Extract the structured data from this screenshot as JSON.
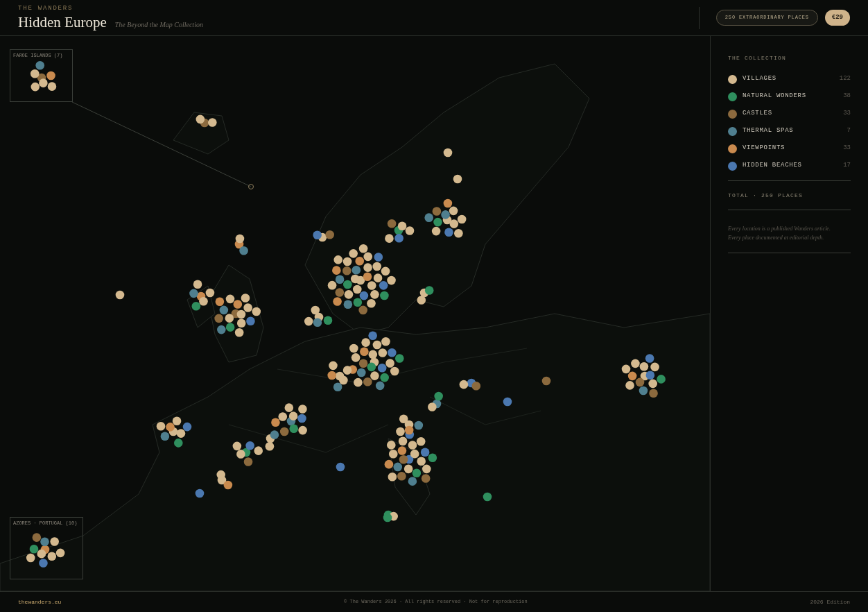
{
  "header": {
    "brand": "THE WANDERS",
    "title": "Hidden Europe",
    "subtitle": "The Beyond the Map Collection",
    "places_badge": "250 EXTRAORDINARY PLACES",
    "price_button": "€29"
  },
  "map": {
    "kind": "picture",
    "insets": [
      {
        "label": "FAROE ISLANDS (7)"
      },
      {
        "label": "AZORES · PORTUGAL (10)"
      }
    ]
  },
  "legend": {
    "title": "THE COLLECTION",
    "categories": [
      {
        "label": "VILLAGES",
        "count": "122",
        "color": "#d4b98f"
      },
      {
        "label": "NATURAL WONDERS",
        "count": "38",
        "color": "#2f8f5e"
      },
      {
        "label": "CASTLES",
        "count": "33",
        "color": "#8c6a3e"
      },
      {
        "label": "THERMAL SPAS",
        "count": "7",
        "color": "#4f7f8f"
      },
      {
        "label": "VIEWPOINTS",
        "count": "33",
        "color": "#c98a4e"
      },
      {
        "label": "HIDDEN BEACHES",
        "count": "17",
        "color": "#4b78b0"
      }
    ],
    "total": "TOTAL · 250 PLACES",
    "note": "Every location is a published Wanders article.\nEvery place documented at editorial depth."
  },
  "footer": {
    "site": "thewanders.eu",
    "copyright": "© The Wanders 2026 · All rights reserved · Not for reproduction",
    "edition": "2026 Edition"
  }
}
